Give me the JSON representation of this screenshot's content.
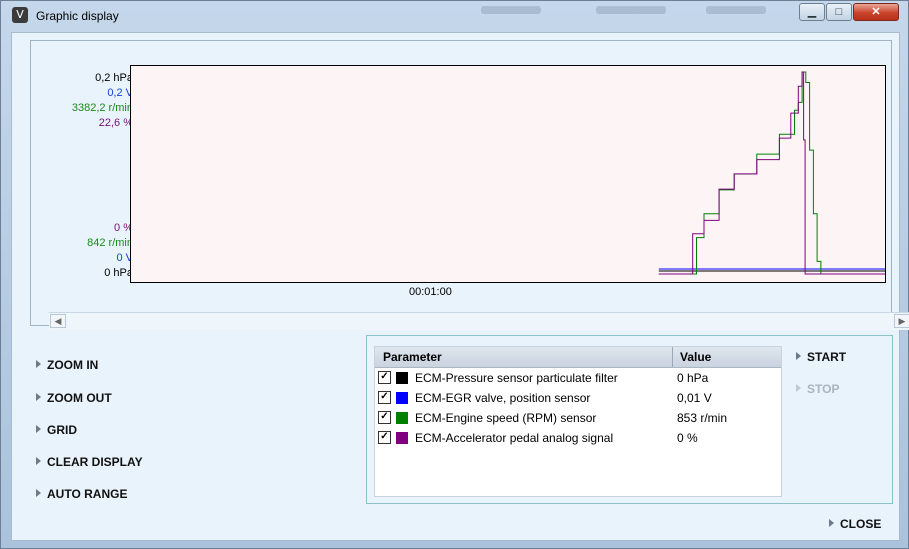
{
  "window": {
    "title": "Graphic display",
    "app_icon_glyph": "V",
    "buttons": {
      "minimize": "▁",
      "maximize": "□",
      "close": "✕"
    }
  },
  "chart": {
    "y_labels_top": [
      {
        "text": "0,2 hPa",
        "color": "#000000"
      },
      {
        "text": "0,2 V",
        "color": "#1a3fd6"
      },
      {
        "text": "3382,2 r/min",
        "color": "#1a8a1a"
      },
      {
        "text": "22,6 %",
        "color": "#7a0f7a"
      }
    ],
    "y_labels_bottom": [
      {
        "text": "0 %",
        "color": "#7a0f7a"
      },
      {
        "text": "842 r/min",
        "color": "#1a8a1a"
      },
      {
        "text": "0 V",
        "color": "#1a3fd6"
      },
      {
        "text": "0 hPa",
        "color": "#000000"
      }
    ],
    "time_label": "00:01:00"
  },
  "chart_data": {
    "type": "line",
    "x_label": "00:01:00",
    "series": [
      {
        "name": "ECM-Pressure sensor particulate filter",
        "color": "#000000",
        "y_range": [
          0,
          0.2
        ],
        "points": [
          [
            0.7,
            0.0
          ],
          [
            1.0,
            0.0
          ]
        ]
      },
      {
        "name": "ECM-EGR valve, position sensor",
        "color": "#0000ff",
        "y_range": [
          0,
          0.2
        ],
        "points": [
          [
            0.7,
            0.0
          ],
          [
            1.0,
            0.0
          ]
        ]
      },
      {
        "name": "ECM-Engine speed (RPM) sensor",
        "color": "#008000",
        "y_range": [
          842,
          3382.2
        ],
        "points": [
          [
            0.7,
            842
          ],
          [
            0.745,
            842
          ],
          [
            0.75,
            1300
          ],
          [
            0.76,
            1600
          ],
          [
            0.78,
            1900
          ],
          [
            0.8,
            2100
          ],
          [
            0.83,
            2350
          ],
          [
            0.86,
            2600
          ],
          [
            0.88,
            2900
          ],
          [
            0.885,
            3000
          ],
          [
            0.89,
            3382
          ],
          [
            0.895,
            3250
          ],
          [
            0.9,
            2400
          ],
          [
            0.905,
            1600
          ],
          [
            0.91,
            1000
          ],
          [
            0.915,
            842
          ],
          [
            1.0,
            842
          ]
        ]
      },
      {
        "name": "ECM-Accelerator pedal analog signal",
        "color": "#800080",
        "y_range": [
          0,
          22.6
        ],
        "points": [
          [
            0.7,
            0
          ],
          [
            0.74,
            0
          ],
          [
            0.745,
            4.5
          ],
          [
            0.76,
            6
          ],
          [
            0.78,
            9.5
          ],
          [
            0.8,
            11.2
          ],
          [
            0.83,
            12.8
          ],
          [
            0.86,
            15.2
          ],
          [
            0.875,
            18
          ],
          [
            0.885,
            21
          ],
          [
            0.89,
            22.6
          ],
          [
            0.892,
            15
          ],
          [
            0.894,
            0
          ],
          [
            1.0,
            0
          ]
        ]
      }
    ]
  },
  "commands": {
    "zoom_in": "ZOOM IN",
    "zoom_out": "ZOOM OUT",
    "grid": "GRID",
    "clear_display": "CLEAR DISPLAY",
    "auto_range": "AUTO RANGE",
    "start": "START",
    "stop": "STOP",
    "close": "CLOSE"
  },
  "table": {
    "headers": {
      "parameter": "Parameter",
      "value": "Value"
    },
    "rows": [
      {
        "checked": "✓",
        "color": "#000000",
        "name": "ECM-Pressure sensor particulate filter",
        "value": "0 hPa"
      },
      {
        "checked": "✓",
        "color": "#0000ff",
        "name": "ECM-EGR valve, position sensor",
        "value": "0,01 V"
      },
      {
        "checked": "✓",
        "color": "#008000",
        "name": "ECM-Engine speed (RPM) sensor",
        "value": "853 r/min"
      },
      {
        "checked": "✓",
        "color": "#800080",
        "name": "ECM-Accelerator pedal analog signal",
        "value": "0 %"
      }
    ]
  }
}
